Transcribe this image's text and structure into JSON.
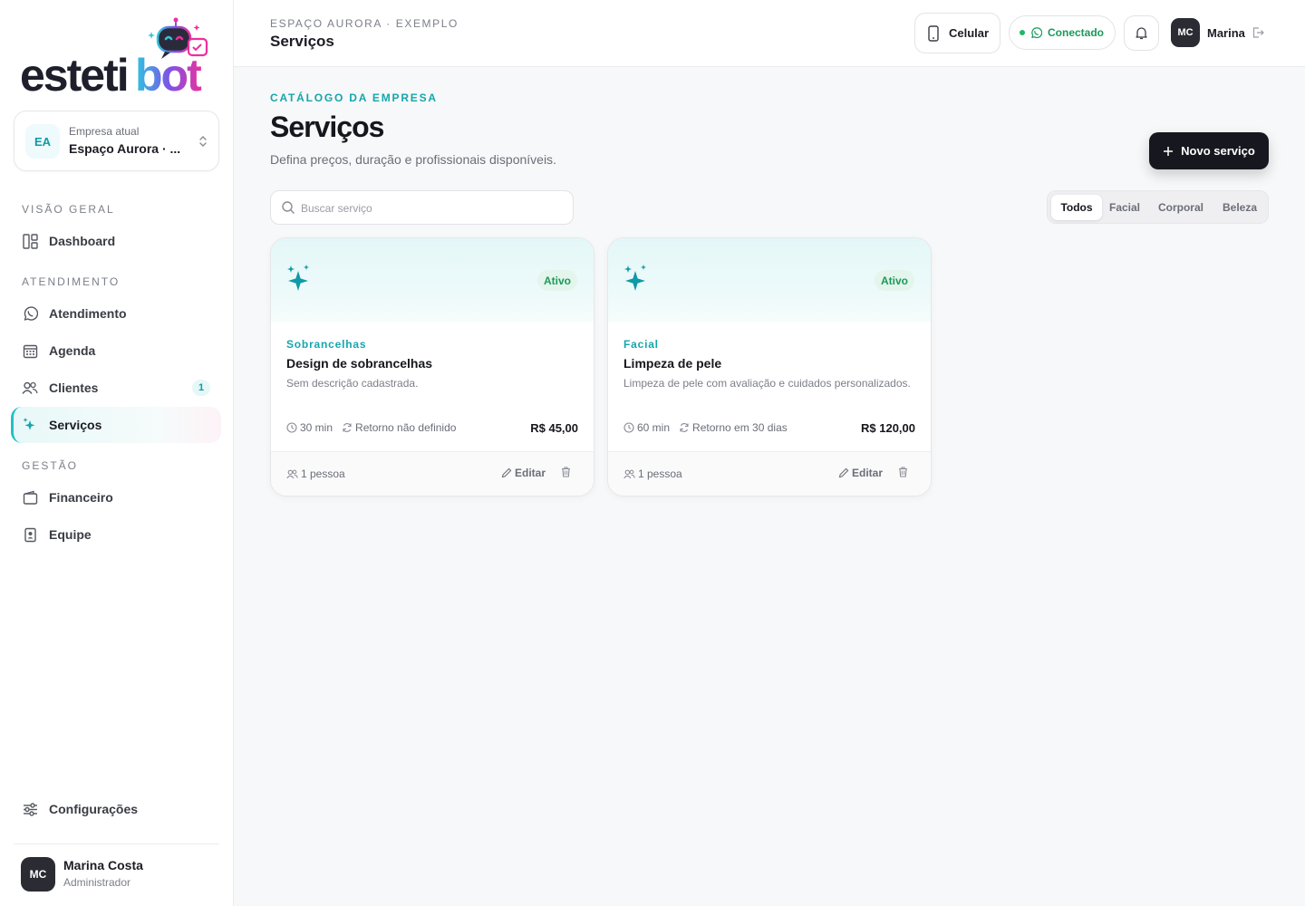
{
  "brand": {
    "logo_text_dark": "esteti",
    "logo_text_accent": "bot"
  },
  "company_switcher": {
    "initials": "EA",
    "label": "Empresa atual",
    "name": "Espaço Aurora · ..."
  },
  "sidebar": {
    "sections": {
      "overview": "VISÃO GERAL",
      "service": "ATENDIMENTO",
      "management": "GESTÃO"
    },
    "items": [
      {
        "label": "Dashboard",
        "icon": "dashboard-icon"
      },
      {
        "label": "Atendimento",
        "icon": "whatsapp-icon"
      },
      {
        "label": "Agenda",
        "icon": "calendar-icon"
      },
      {
        "label": "Clientes",
        "icon": "users-icon",
        "badge": "1"
      },
      {
        "label": "Serviços",
        "icon": "sparkles-icon",
        "active": true
      },
      {
        "label": "Financeiro",
        "icon": "wallet-icon"
      },
      {
        "label": "Equipe",
        "icon": "badge-icon"
      }
    ],
    "settings_label": "Configurações",
    "user": {
      "initials": "MC",
      "name": "Marina Costa",
      "role": "Administrador"
    }
  },
  "topbar": {
    "breadcrumb": "ESPAÇO AURORA · EXEMPLO",
    "title": "Serviços",
    "phone_label": "Celular",
    "connection_label": "Conectado",
    "user_initials": "MC",
    "user_name": "Marina"
  },
  "page": {
    "eyebrow": "CATÁLOGO DA EMPRESA",
    "title": "Serviços",
    "subtitle": "Defina preços, duração e profissionais disponíveis.",
    "new_button": "Novo serviço",
    "search_placeholder": "Buscar serviço",
    "filters": [
      "Todos",
      "Facial",
      "Corporal",
      "Beleza"
    ],
    "active_filter": "Todos"
  },
  "services": [
    {
      "status": "Ativo",
      "category": "Sobrancelhas",
      "name": "Design de sobrancelhas",
      "description": "Sem descrição cadastrada.",
      "duration": "30 min",
      "return": "Retorno não definido",
      "price": "R$ 45,00",
      "professionals": "1 pessoa",
      "edit_label": "Editar"
    },
    {
      "status": "Ativo",
      "category": "Facial",
      "name": "Limpeza de pele",
      "description": "Limpeza de pele com avaliação e cuidados personalizados.",
      "duration": "60 min",
      "return": "Retorno em 30 dias",
      "price": "R$ 120,00",
      "professionals": "1 pessoa",
      "edit_label": "Editar"
    }
  ],
  "colors": {
    "accent": "#14a6ad",
    "success": "#1a9a5a",
    "dark": "#17181f",
    "logo_gradient": [
      "#2fc6e0",
      "#ec2f9e"
    ]
  }
}
